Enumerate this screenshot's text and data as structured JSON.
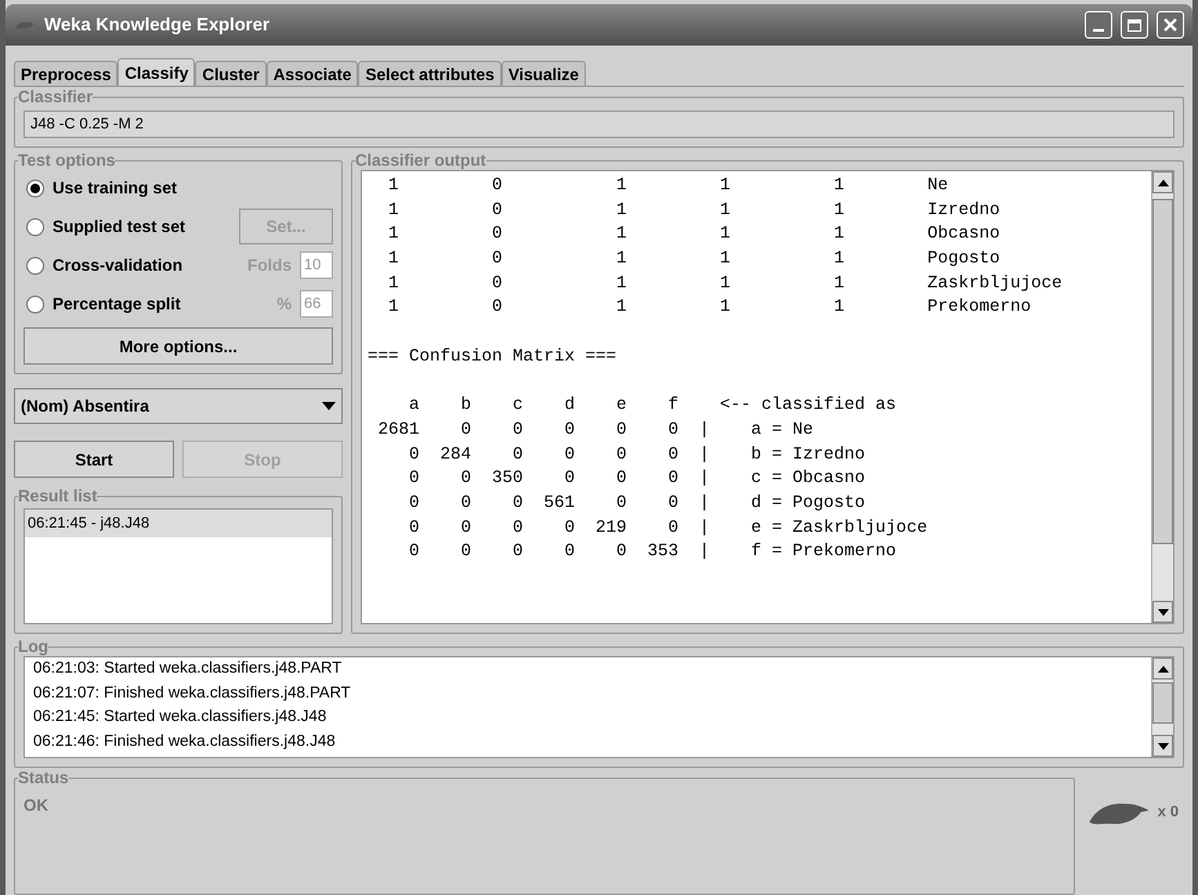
{
  "window": {
    "title": "Weka Knowledge Explorer"
  },
  "tabs": [
    {
      "label": "Preprocess",
      "selected": false
    },
    {
      "label": "Classify",
      "selected": true
    },
    {
      "label": "Cluster",
      "selected": false
    },
    {
      "label": "Associate",
      "selected": false
    },
    {
      "label": "Select attributes",
      "selected": false
    },
    {
      "label": "Visualize",
      "selected": false
    }
  ],
  "classifier": {
    "label": "Classifier",
    "value": "J48 -C 0.25 -M 2"
  },
  "test_options": {
    "label": "Test options",
    "options": [
      {
        "label": "Use training set",
        "selected": true,
        "kind": "plain"
      },
      {
        "label": "Supplied test set",
        "selected": false,
        "kind": "button",
        "button": "Set...",
        "disabled": true
      },
      {
        "label": "Cross-validation",
        "selected": false,
        "kind": "field",
        "field_label": "Folds",
        "value": "10",
        "disabled": true
      },
      {
        "label": "Percentage split",
        "selected": false,
        "kind": "field",
        "field_label": "%",
        "value": "66",
        "disabled": true
      }
    ],
    "more_button": "More options..."
  },
  "class_select": {
    "value": "(Nom) Absentira"
  },
  "buttons": [
    {
      "label": "Start",
      "disabled": false
    },
    {
      "label": "Stop",
      "disabled": true
    }
  ],
  "result_list": {
    "label": "Result list",
    "items": [
      {
        "text": "06:21:45 - j48.J48",
        "selected": true
      }
    ]
  },
  "output": {
    "label": "Classifier output",
    "accuracy_lines": [
      "  1         0           1         1          1        Ne",
      "  1         0           1         1          1        Izredno",
      "  1         0           1         1          1        Obcasno",
      "  1         0           1         1          1        Pogosto",
      "  1         0           1         1          1        Zaskrbljujoce",
      "  1         0           1         1          1        Prekomerno"
    ],
    "matrix_title": "=== Confusion Matrix ===",
    "matrix_lines": [
      "    a    b    c    d    e    f    <-- classified as",
      " 2681    0    0    0    0    0  |    a = Ne",
      "    0  284    0    0    0    0  |    b = Izredno",
      "    0    0  350    0    0    0  |    c = Obcasno",
      "    0    0    0  561    0    0  |    d = Pogosto",
      "    0    0    0    0  219    0  |    e = Zaskrbljujoce",
      "    0    0    0    0    0  353  |    f = Prekomerno"
    ]
  },
  "log": {
    "label": "Log",
    "lines": [
      "06:21:03: Started weka.classifiers.j48.PART",
      "06:21:07: Finished weka.classifiers.j48.PART",
      "06:21:45: Started weka.classifiers.j48.J48",
      "06:21:46: Finished weka.classifiers.j48.J48"
    ]
  },
  "status": {
    "label": "Status",
    "text": "OK",
    "workers": "x 0"
  }
}
